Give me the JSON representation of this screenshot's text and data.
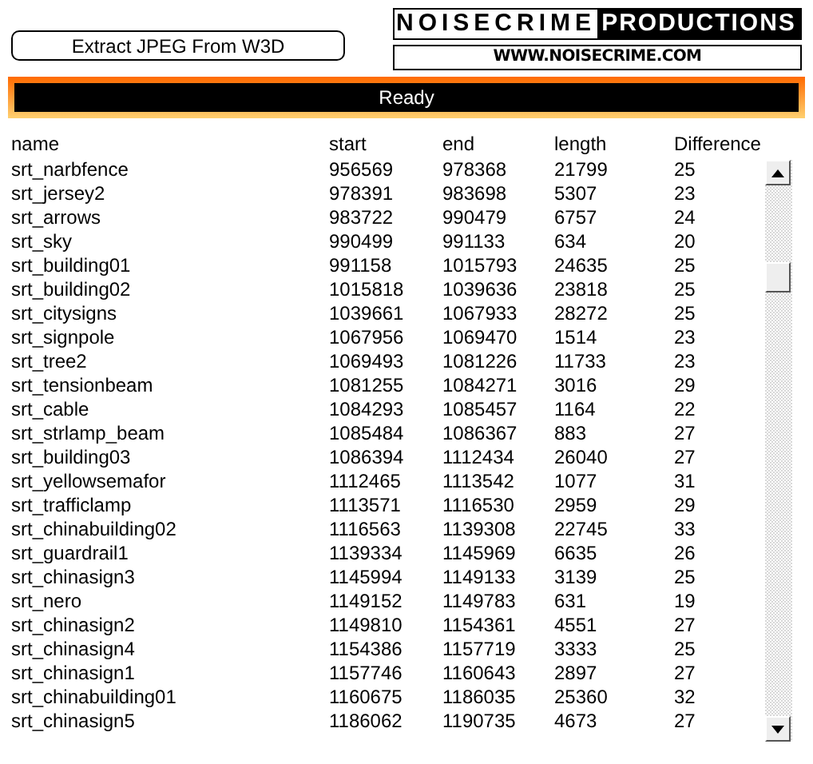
{
  "button": {
    "label": "Extract JPEG From W3D"
  },
  "logo": {
    "left": "NOISECRIME",
    "right": "PRODUCTIONS",
    "url": "WWW.NOISECRIME.COM"
  },
  "status": "Ready",
  "table": {
    "columns": [
      "name",
      "start",
      "end",
      "length",
      "Difference"
    ],
    "rows": [
      [
        "srt_narbfence",
        "956569",
        "978368",
        "21799",
        "25"
      ],
      [
        "srt_jersey2",
        "978391",
        "983698",
        "5307",
        "23"
      ],
      [
        "srt_arrows",
        "983722",
        "990479",
        "6757",
        "24"
      ],
      [
        "srt_sky",
        "990499",
        "991133",
        "634",
        "20"
      ],
      [
        "srt_building01",
        "991158",
        "1015793",
        "24635",
        "25"
      ],
      [
        "srt_building02",
        "1015818",
        "1039636",
        "23818",
        "25"
      ],
      [
        "srt_citysigns",
        "1039661",
        "1067933",
        "28272",
        "25"
      ],
      [
        "srt_signpole",
        "1067956",
        "1069470",
        "1514",
        "23"
      ],
      [
        "srt_tree2",
        "1069493",
        "1081226",
        "11733",
        "23"
      ],
      [
        "srt_tensionbeam",
        "1081255",
        "1084271",
        "3016",
        "29"
      ],
      [
        "srt_cable",
        "1084293",
        "1085457",
        "1164",
        "22"
      ],
      [
        "srt_strlamp_beam",
        "1085484",
        "1086367",
        "883",
        "27"
      ],
      [
        "srt_building03",
        "1086394",
        "1112434",
        "26040",
        "27"
      ],
      [
        "srt_yellowsemafor",
        "1112465",
        "1113542",
        "1077",
        "31"
      ],
      [
        "srt_trafficlamp",
        "1113571",
        "1116530",
        "2959",
        "29"
      ],
      [
        "srt_chinabuilding02",
        "1116563",
        "1139308",
        "22745",
        "33"
      ],
      [
        "srt_guardrail1",
        "1139334",
        "1145969",
        "6635",
        "26"
      ],
      [
        "srt_chinasign3",
        "1145994",
        "1149133",
        "3139",
        "25"
      ],
      [
        "srt_nero",
        "1149152",
        "1149783",
        "631",
        "19"
      ],
      [
        "srt_chinasign2",
        "1149810",
        "1154361",
        "4551",
        "27"
      ],
      [
        "srt_chinasign4",
        "1154386",
        "1157719",
        "3333",
        "25"
      ],
      [
        "srt_chinasign1",
        "1157746",
        "1160643",
        "2897",
        "27"
      ],
      [
        "srt_chinabuilding01",
        "1160675",
        "1186035",
        "25360",
        "32"
      ],
      [
        "srt_chinasign5",
        "1186062",
        "1190735",
        "4673",
        "27"
      ]
    ]
  }
}
